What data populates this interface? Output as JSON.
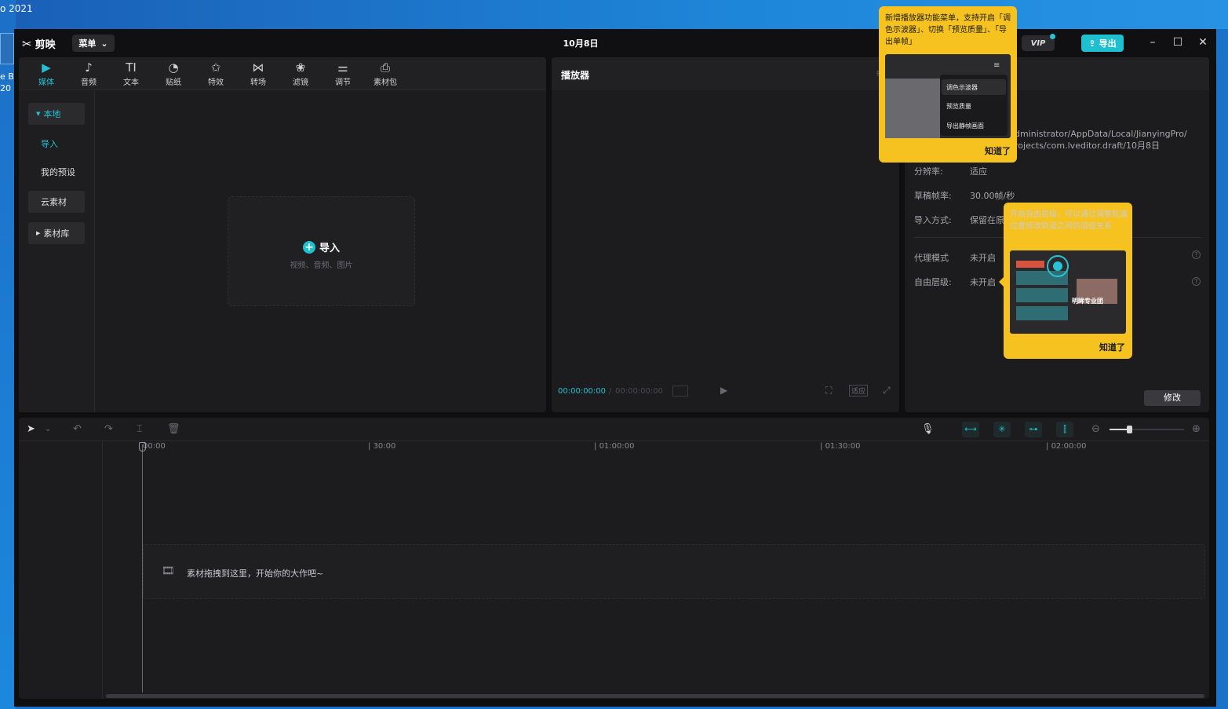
{
  "desktop": {
    "top_text": "o 2021",
    "side_text": [
      "e B",
      "20"
    ]
  },
  "window": {
    "app_name": "剪映",
    "menu_label": "菜单",
    "title": "10月8日",
    "vip_label": "VIP",
    "export_label": "导出",
    "controls": [
      "–",
      "☐",
      "✕"
    ]
  },
  "media": {
    "tabs": [
      {
        "label": "媒体",
        "icon": "media-icon",
        "glyph": "▶"
      },
      {
        "label": "音频",
        "icon": "audio-icon",
        "glyph": "♪"
      },
      {
        "label": "文本",
        "icon": "text-icon",
        "glyph": "TI"
      },
      {
        "label": "贴纸",
        "icon": "sticker-icon",
        "glyph": "◔"
      },
      {
        "label": "特效",
        "icon": "effects-icon",
        "glyph": "✩"
      },
      {
        "label": "转场",
        "icon": "transition-icon",
        "glyph": "⋈"
      },
      {
        "label": "滤镜",
        "icon": "filter-icon",
        "glyph": "❀"
      },
      {
        "label": "调节",
        "icon": "adjust-icon",
        "glyph": "⚌"
      },
      {
        "label": "素材包",
        "icon": "package-icon",
        "glyph": "⎙"
      }
    ],
    "sidebar": {
      "local": "本地",
      "import": "导入",
      "my_presets": "我的预设",
      "cloud": "云素材",
      "library": "素材库"
    },
    "import_box": {
      "label": "导入",
      "hint": "视频、音频、图片"
    }
  },
  "player": {
    "title": "播放器",
    "current_time": "00:00:00:00",
    "separator": "/",
    "total_time": "00:00:00:00",
    "fit_label": "适应"
  },
  "properties": {
    "path_line1": "dministrator/AppData/Local/JianyingPro/",
    "path_line2": "rojects/com.lveditor.draft/10月8日",
    "rows": [
      {
        "label": "分辨率:",
        "value": "适应"
      },
      {
        "label": "草稿帧率:",
        "value": "30.00帧/秒"
      },
      {
        "label": "导入方式:",
        "value": "保留在原"
      },
      {
        "label": "代理模式",
        "value": "未开启"
      },
      {
        "label": "自由层级:",
        "value": "未开启"
      }
    ],
    "modify_label": "修改"
  },
  "timeline": {
    "ruler": [
      "00:00",
      "30:00",
      "01:00:00",
      "01:30:00",
      "02:00:00"
    ],
    "drop_text": "素材拖拽到这里，开始你的大作吧~"
  },
  "tip_player": {
    "text": "新增播放器功能菜单，支持开启「调色示波器」、切换「预览质量」、「导出单帧」",
    "menu_items": [
      "调色示波器",
      "预览质量",
      "导出静帧画面"
    ],
    "ok": "知道了"
  },
  "tip_layer": {
    "text": "开启自由层级，可以通过调整轨道位置修改轨道之间的层级关系",
    "image_caption": "明眸专业团",
    "ok": "知道了"
  },
  "colors": {
    "accent": "#1ec0d0",
    "tooltip": "#f6c21f",
    "panel": "#1c1c1e"
  }
}
